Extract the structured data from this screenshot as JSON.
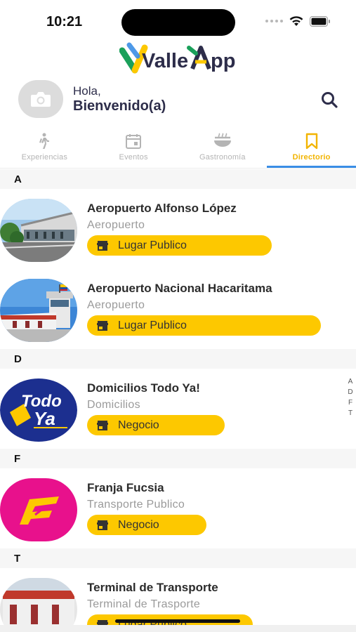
{
  "status_bar": {
    "time": "10:21"
  },
  "app": {
    "logo_text_left": "Valle",
    "logo_text_right": "pp"
  },
  "header": {
    "greeting": "Hola,",
    "welcome": "Bienvenido(a)"
  },
  "tabs": [
    {
      "label": "Experiencias",
      "icon": "hiker-icon",
      "active": false
    },
    {
      "label": "Eventos",
      "icon": "calendar-icon",
      "active": false
    },
    {
      "label": "Gastronomía",
      "icon": "food-bowl-icon",
      "active": false
    },
    {
      "label": "Directorio",
      "icon": "bookmark-icon",
      "active": true
    }
  ],
  "sections": [
    {
      "letter": "A",
      "items": [
        {
          "name": "Aeropuerto Alfonso López",
          "category": "Aeropuerto",
          "tag": "Lugar Publico"
        },
        {
          "name": "Aeropuerto Nacional Hacaritama",
          "category": "Aeropuerto",
          "tag": "Lugar Publico"
        }
      ]
    },
    {
      "letter": "D",
      "items": [
        {
          "name": "Domicilios Todo Ya!",
          "category": "Domicilios",
          "tag": "Negocio"
        }
      ]
    },
    {
      "letter": "F",
      "items": [
        {
          "name": "Franja Fucsia",
          "category": "Transporte Publico",
          "tag": "Negocio"
        }
      ]
    },
    {
      "letter": "T",
      "items": [
        {
          "name": "Terminal de Transporte",
          "category": "Terminal de Trasporte",
          "tag": "Lugar Publico"
        }
      ]
    }
  ],
  "alpha_index": [
    "A",
    "D",
    "F",
    "T"
  ],
  "thumb_text": {
    "todo_ya_line1": "Todo",
    "todo_ya_line2": "Ya"
  },
  "colors": {
    "accent_yellow": "#fdc800",
    "tab_active_label": "#f2b400",
    "tab_indicator": "#3a8ee6",
    "brand_navy": "#2d2d4a",
    "fucsia": "#e8118c"
  }
}
